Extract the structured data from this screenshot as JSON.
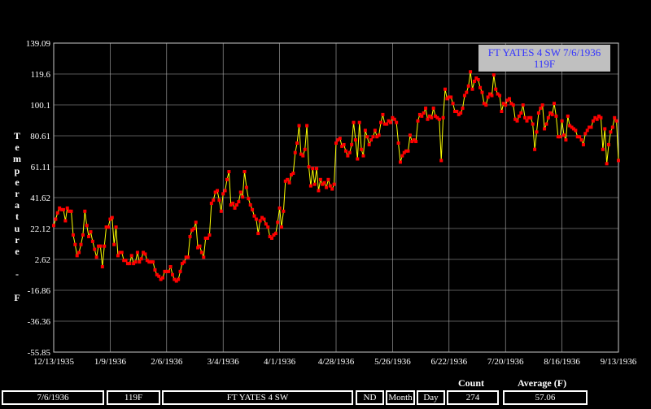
{
  "chart_data": {
    "type": "line",
    "xlabel": "",
    "ylabel": "Temperature - F",
    "ylim": [
      -55.85,
      139.09
    ],
    "yticks": [
      "139.09",
      "119.6",
      "100.1",
      "80.61",
      "61.11",
      "41.62",
      "22.12",
      "2.62",
      "-16.86",
      "-36.36",
      "-55.85"
    ],
    "xticks": [
      "12/13/1935",
      "1/9/1936",
      "2/6/1936",
      "3/4/1936",
      "4/1/1936",
      "4/28/1936",
      "5/26/1936",
      "6/22/1936",
      "7/20/1936",
      "8/16/1936",
      "9/13/1936"
    ],
    "grid": true,
    "line_color": "#ffff00",
    "marker_color": "#ff0000",
    "annotation": {
      "line1": "FT YATES 4 SW 7/6/1936",
      "line2": "119F",
      "color": "#3333ff",
      "background": "#c0c0c0"
    },
    "series": [
      {
        "values": [
          24,
          28,
          32,
          35,
          34,
          34,
          27,
          35,
          33,
          33,
          18,
          12,
          5,
          7,
          12,
          18,
          33,
          24,
          17,
          20,
          14,
          9,
          4,
          11,
          11,
          -2,
          11,
          23,
          23,
          28,
          29,
          12,
          23,
          5,
          7,
          7,
          2,
          2,
          0,
          0,
          5,
          0,
          1,
          7,
          1,
          3,
          7,
          6,
          2,
          1,
          1,
          1,
          -4,
          -7,
          -8,
          -10,
          -9,
          -5,
          -5,
          -5,
          -2,
          -7,
          -10,
          -11,
          -10,
          -5,
          0,
          1,
          4,
          4,
          17,
          21,
          22,
          26,
          10,
          11,
          7,
          4,
          16,
          16,
          18,
          38,
          40,
          45,
          46,
          40,
          33,
          44,
          46,
          53,
          58,
          37,
          38,
          35,
          37,
          39,
          45,
          42,
          58,
          48,
          41,
          37,
          34,
          30,
          28,
          19,
          27,
          29,
          28,
          25,
          23,
          17,
          16,
          18,
          19,
          26,
          35,
          23,
          33,
          52,
          53,
          51,
          56,
          57,
          70,
          76,
          87,
          69,
          68,
          72,
          87,
          61,
          49,
          60,
          50,
          60,
          46,
          53,
          50,
          51,
          48,
          53,
          49,
          47,
          50,
          76,
          78,
          79,
          74,
          75,
          71,
          68,
          70,
          75,
          89,
          78,
          66,
          89,
          72,
          68,
          84,
          80,
          75,
          78,
          80,
          84,
          80,
          81,
          89,
          94,
          88,
          88,
          90,
          89,
          92,
          91,
          89,
          76,
          64,
          68,
          70,
          71,
          71,
          81,
          77,
          78,
          77,
          90,
          94,
          93,
          95,
          98,
          91,
          93,
          92,
          98,
          93,
          92,
          91,
          65,
          92,
          110,
          104,
          105,
          105,
          101,
          96,
          96,
          94,
          95,
          98,
          106,
          108,
          112,
          121,
          110,
          115,
          117,
          116,
          111,
          108,
          101,
          100,
          105,
          107,
          106,
          119,
          110,
          107,
          106,
          96,
          101,
          100,
          103,
          104,
          101,
          100,
          91,
          90,
          93,
          95,
          100,
          92,
          90,
          92,
          92,
          88,
          72,
          83,
          95,
          98,
          100,
          85,
          88,
          92,
          95,
          94,
          101,
          93,
          80,
          80,
          90,
          81,
          78,
          93,
          87,
          86,
          85,
          84,
          80,
          80,
          78,
          75,
          82,
          84,
          86,
          86,
          90,
          92,
          91,
          93,
          92,
          72,
          85,
          63,
          75,
          83,
          86,
          92,
          90,
          65
        ]
      }
    ]
  },
  "status": {
    "count_header": "Count",
    "average_header": "Average (F)",
    "date": "7/6/1936",
    "value": "119F",
    "station": "FT YATES 4 SW",
    "nd_label": "ND",
    "month_label": "Month",
    "day_label": "Day",
    "count": "274",
    "average": "57.06"
  }
}
